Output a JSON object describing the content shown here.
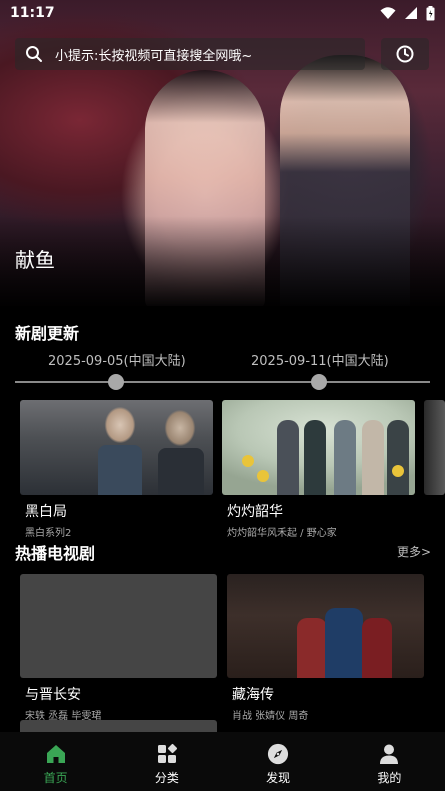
{
  "status_bar": {
    "time": "11:17"
  },
  "search": {
    "placeholder": "小提示:长按视频可直接搜全网哦~"
  },
  "hero": {
    "title": "献鱼"
  },
  "new_dramas": {
    "title": "新剧更新",
    "dates": [
      "2025-09-05(中国大陆)",
      "2025-09-11(中国大陆)"
    ],
    "items": [
      {
        "title": "黑白局",
        "subtitle": "黑白系列2"
      },
      {
        "title": "灼灼韶华",
        "subtitle": "灼灼韶华风禾起 / 野心家"
      }
    ]
  },
  "hot_tv": {
    "title": "热播电视剧",
    "more": "更多>",
    "items": [
      {
        "title": "与晋长安",
        "subtitle": "宋轶 丞磊 毕雯珺"
      },
      {
        "title": "藏海传",
        "subtitle": "肖战 张婧仪 周奇"
      }
    ]
  },
  "bottom_nav": {
    "items": [
      {
        "label": "首页",
        "icon": "home-icon",
        "active": true
      },
      {
        "label": "分类",
        "icon": "category-icon",
        "active": false
      },
      {
        "label": "发现",
        "icon": "compass-icon",
        "active": false
      },
      {
        "label": "我的",
        "icon": "profile-icon",
        "active": false
      }
    ]
  },
  "colors": {
    "accent": "#3aa655",
    "background": "#000000"
  }
}
